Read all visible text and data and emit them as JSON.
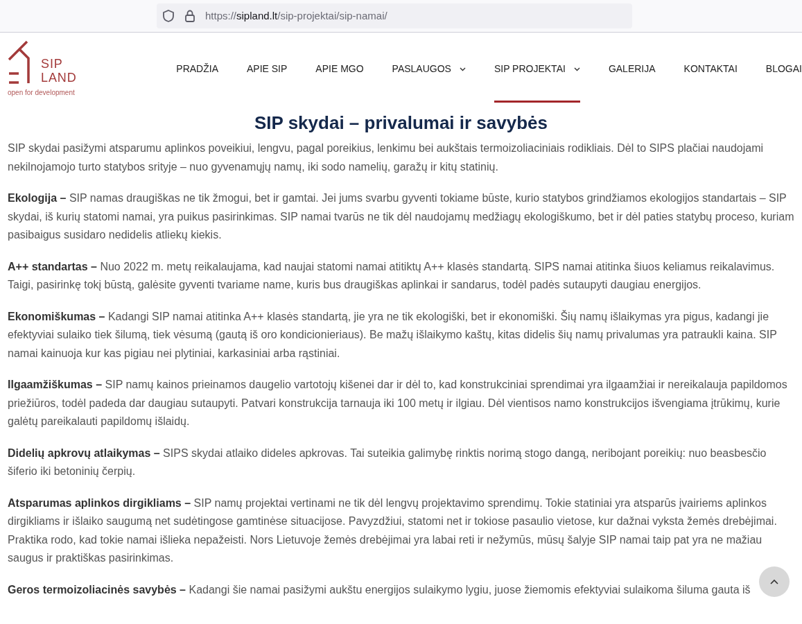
{
  "browser": {
    "url_host": "sipland.lt",
    "url_scheme": "https://",
    "url_path": "/sip-projektai/sip-namai/"
  },
  "logo": {
    "line_1": "SIP",
    "line_2": "LAND",
    "tagline": "open for development"
  },
  "nav": [
    {
      "label": "PRADŽIA",
      "selected": false,
      "dropdown": false
    },
    {
      "label": "APIE SIP",
      "selected": false,
      "dropdown": false
    },
    {
      "label": "APIE MGO",
      "selected": false,
      "dropdown": false
    },
    {
      "label": "PASLAUGOS",
      "selected": false,
      "dropdown": true
    },
    {
      "label": "SIP PROJEKTAI",
      "selected": true,
      "dropdown": true
    },
    {
      "label": "GALERIJA",
      "selected": false,
      "dropdown": false
    },
    {
      "label": "KONTAKTAI",
      "selected": false,
      "dropdown": false
    },
    {
      "label": "BLOGAI",
      "selected": false,
      "dropdown": false
    }
  ],
  "heading": "SIP skydai – privalumai ir savybės",
  "paragraphs": [
    "SIP skydai pasižymi atsparumu aplinkos poveikiui, lengvu, pagal poreikius, lenkimu bei aukštais termoizoliaciniais rodikliais. Dėl to SIPS plačiai naudojami nekilnojamojo turto statybos srityje – nuo gyvenamųjų namų, iki sodo namelių, garažų ir kitų statinių.",
    "**Ekologija –** SIP namas draugiškas ne tik žmogui, bet ir gamtai. Jei jums svarbu gyventi tokiame būste, kurio statybos grindžiamos ekologijos standartais – SIP skydai, iš kurių statomi namai, yra puikus pasirinkimas. SIP namai tvarūs ne tik dėl naudojamų medžiagų ekologiškumo, bet ir dėl paties statybų proceso, kuriam pasibaigus susidaro nedidelis atliekų kiekis.",
    "**A++ standartas –** Nuo 2022 m. metų reikalaujama, kad naujai statomi namai atitiktų A++ klasės standartą. SIPS namai atitinka šiuos keliamus reikalavimus. Taigi, pasirinkę tokį būstą, galėsite gyventi tvariame name, kuris bus draugiškas aplinkai ir sandarus, todėl padės sutaupyti daugiau energijos.",
    "**Ekonomiškumas –** Kadangi SIP namai atitinka A++ klasės standartą, jie yra ne tik ekologiški, bet ir ekonomiški. Šių namų išlaikymas yra pigus, kadangi jie efektyviai sulaiko tiek šilumą, tiek vėsumą (gautą iš oro kondicionieriaus). Be mažų išlaikymo kaštų, kitas didelis šių namų privalumas yra patraukli kaina. SIP namai kainuoja kur kas pigiau nei plytiniai, karkasiniai arba rąstiniai.",
    "**Ilgaamžiškumas –** SIP namų kainos prieinamos daugelio vartotojų kišenei dar ir dėl to, kad konstrukciniai sprendimai yra ilgaamžiai ir nereikalauja papildomos priežiūros, todėl padeda dar daugiau sutaupyti. Patvari konstrukcija tarnauja iki 100 metų ir ilgiau. Dėl vientisos namo konstrukcijos išvengiama įtrūkimų, kurie galėtų pareikalauti papildomų išlaidų.",
    "**Didelių apkrovų atlaikymas –** SIPS skydai atlaiko dideles apkrovas. Tai suteikia galimybę rinktis norimą stogo dangą, neribojant poreikių: nuo beasbesčio šiferio iki betoninių čerpių.",
    "**Atsparumas aplinkos dirgikliams –** SIP namų projektai vertinami ne tik dėl lengvų projektavimo sprendimų. Tokie statiniai yra atsparūs įvairiems aplinkos dirgikliams ir išlaiko saugumą net sudėtingose gamtinėse situacijose. Pavyzdžiui, statomi net ir tokiose pasaulio vietose, kur dažnai vyksta žemės drebėjimai. Praktika rodo, kad tokie namai išlieka nepažeisti. Nors Lietuvoje žemės drebėjimai yra labai reti ir nežymūs, mūsų šalyje SIP namai taip pat yra ne mažiau saugus ir praktiškas pasirinkimas.",
    "**Geros termoizoliacinės savybės –** Kadangi šie namai pasižymi aukštu energijos sulaikymo lygiu, juose žiemomis efektyviai sulaikoma šiluma gauta iš"
  ]
}
